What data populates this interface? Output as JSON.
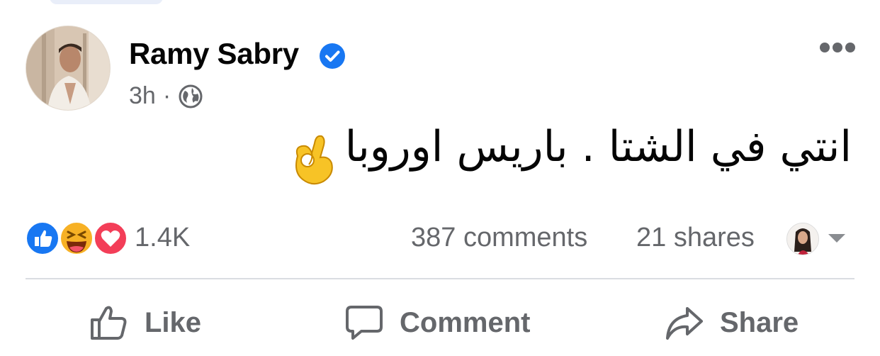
{
  "post": {
    "author": "Ramy Sabry",
    "time": "3h",
    "separator": "·",
    "text": "انتي في الشتا . باريس اوروبا",
    "icons": {
      "verified": "verified-badge-icon",
      "audience": "globe-icon",
      "more": "more-options-icon",
      "emoji": "ok-hand-emoji"
    }
  },
  "stats": {
    "reactions": [
      "like",
      "haha",
      "love"
    ],
    "reactions_count": "1.4K",
    "comments": "387 comments",
    "shares": "21 shares"
  },
  "actions": {
    "like": "Like",
    "comment": "Comment",
    "share": "Share"
  },
  "colors": {
    "facebook_blue": "#1877f2",
    "love_red": "#f33e58",
    "haha_yellow": "#f7b125",
    "secondary_text": "#65676b",
    "divider": "#dadde1"
  }
}
